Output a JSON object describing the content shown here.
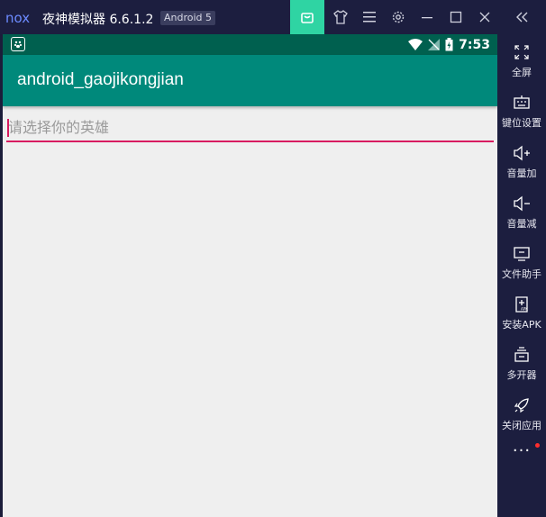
{
  "titlebar": {
    "logo": "nox",
    "title": "夜神模拟器 6.6.1.2",
    "android_badge": "Android 5",
    "buttons": [
      "bag-icon",
      "shirt-icon",
      "menu-icon",
      "gear-icon",
      "minimize-icon",
      "maximize-icon",
      "close-icon"
    ],
    "accent": "#2fd4a3"
  },
  "statusbar": {
    "time": "7:53"
  },
  "app": {
    "name": "android_gaojikongjian",
    "input_placeholder": "请选择你的英雄",
    "input_value": "",
    "accent": "#d81b60",
    "toolbar_color": "#00897b",
    "statusbar_color": "#00604f"
  },
  "sidebar": {
    "collapse_icon": "double-chevron-left-icon",
    "items": [
      {
        "label": "全屏",
        "icon": "fullscreen-icon"
      },
      {
        "label": "键位设置",
        "icon": "keyboard-icon"
      },
      {
        "label": "音量加",
        "icon": "volume-up-icon"
      },
      {
        "label": "音量减",
        "icon": "volume-down-icon"
      },
      {
        "label": "文件助手",
        "icon": "file-monitor-icon"
      },
      {
        "label": "安装APK",
        "icon": "apk-icon"
      },
      {
        "label": "多开器",
        "icon": "multi-instance-icon"
      },
      {
        "label": "关闭应用",
        "icon": "rocket-icon"
      }
    ],
    "more": "···"
  }
}
